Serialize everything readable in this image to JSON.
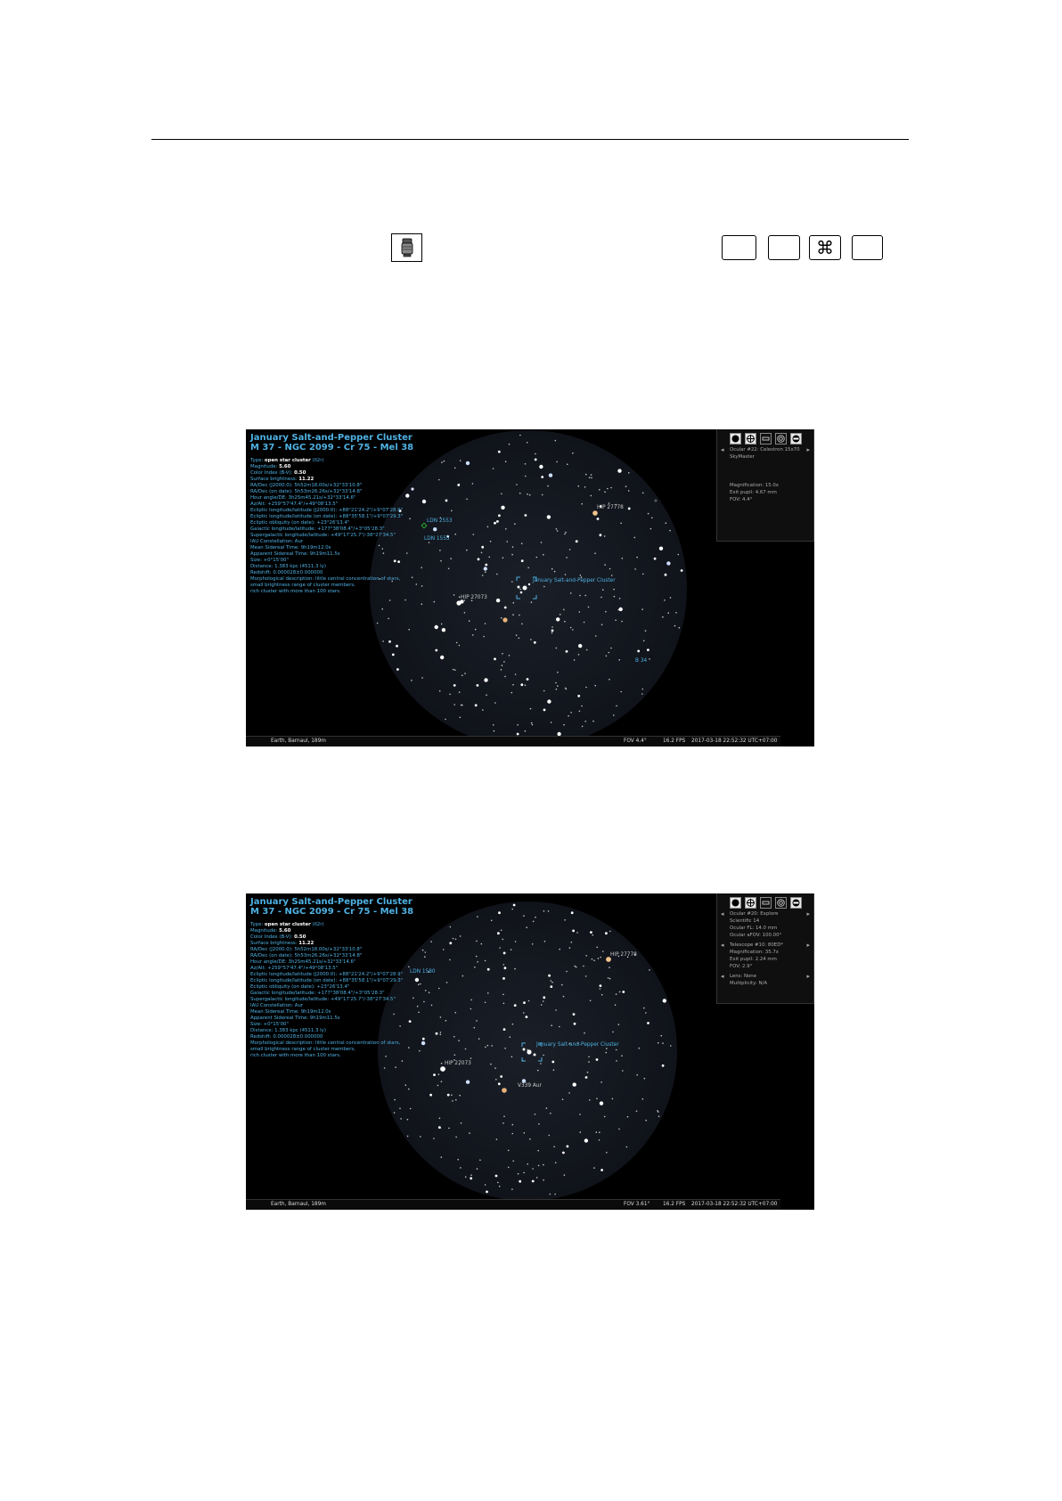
{
  "toolbar": {
    "ocular_icon": "ocular-icon",
    "keys": [
      "",
      "",
      "⌘",
      ""
    ]
  },
  "shot1": {
    "object_title": "January Salt-and-Pepper Cluster",
    "object_subtitle": "M 37 - NGC 2099 - Cr 75 - Mel 38",
    "info_lines": [
      {
        "k": "Type: ",
        "v": "open star cluster",
        "s": " (II2r)"
      },
      {
        "k": "Magnitude: ",
        "v": "5.60",
        "s": ""
      },
      {
        "k": "Color Index (B-V): ",
        "v": "0.50",
        "s": ""
      },
      {
        "k": "Surface brightness: ",
        "v": "11.22",
        "s": ""
      },
      {
        "k": "RA/Dec (J2000.0): 5h52m18.00s/+32°33'10.8\"",
        "v": "",
        "s": ""
      },
      {
        "k": "RA/Dec (on date): 5h53m26.26s/+32°33'14.8\"",
        "v": "",
        "s": ""
      },
      {
        "k": "Hour angle/DE: 3h25m45.21s/+32°33'14.6\"",
        "v": "",
        "s": ""
      },
      {
        "k": "Az/Alt: +259°57'47.4\"/+49°08'13.5\"",
        "v": "",
        "s": ""
      },
      {
        "k": "Ecliptic longitude/latitude (J2000.0): +88°21'24.2\"/+9°07'28.9\"",
        "v": "",
        "s": ""
      },
      {
        "k": "Ecliptic longitude/latitude (on date): +88°35'58.1\"/+9°07'29.3\"",
        "v": "",
        "s": ""
      },
      {
        "k": "Ecliptic obliquity (on date): +23°26'13.4\"",
        "v": "",
        "s": ""
      },
      {
        "k": "Galactic longitude/latitude: +177°38'08.4\"/+3°05'28.3\"",
        "v": "",
        "s": ""
      },
      {
        "k": "Supergalactic longitude/latitude: +49°17'25.7\"/-38°27'34.5\"",
        "v": "",
        "s": ""
      },
      {
        "k": "IAU Constellation: Aur",
        "v": "",
        "s": ""
      },
      {
        "k": "Mean Sidereal Time: 9h19m12.0s",
        "v": "",
        "s": ""
      },
      {
        "k": "Apparent Sidereal Time: 9h19m11.5s",
        "v": "",
        "s": ""
      },
      {
        "k": "Size: +0°15'00\"",
        "v": "",
        "s": ""
      },
      {
        "k": "Distance: 1.383 kpc (4511.3 ly)",
        "v": "",
        "s": ""
      },
      {
        "k": "Redshift: 0.000028±0.000000",
        "v": "",
        "s": ""
      },
      {
        "k": "Morphological description: little central concentration of stars,",
        "v": "",
        "s": ""
      },
      {
        "k": "small brightness range of cluster members,",
        "v": "",
        "s": ""
      },
      {
        "k": "rich cluster with more than 100 stars.",
        "v": "",
        "s": ""
      }
    ],
    "panel": {
      "ocular": "Ocular #22: Celestron 15x70",
      "ocular2": "SkyMaster",
      "magnification": "Magnification: 15.0x",
      "exit_pupil": "Exit pupil: 4.67 mm",
      "fov": "FOV: 4.4°"
    },
    "labels": {
      "hip_a": "HIP 27778",
      "hip_b": "HIP 27073",
      "ldn_a": "LDN 2553",
      "ldn_b": "LDN 1555",
      "cluster": "January Salt-and-Pepper Cluster",
      "b34": "B 34"
    },
    "status": {
      "location": "Earth, Barnaul, 189m",
      "fov": "FOV 4.4°",
      "fps": "16.2 FPS",
      "datetime": "2017-03-18 22:52:32 UTC+07:00"
    }
  },
  "shot2": {
    "object_title": "January Salt-and-Pepper Cluster",
    "object_subtitle": "M 37 - NGC 2099 - Cr 75 - Mel 38",
    "panel": {
      "ocular": "Ocular #20: Explore",
      "ocular2": "Scientific 14",
      "ocular_fl": "Ocular FL: 14.0 mm",
      "ocular_afov": "Ocular aFOV: 100.00°",
      "telescope": "Telescope #10: 80ED*",
      "magnification": "Magnification: 35.7x",
      "exit_pupil": "Exit pupil: 2.24 mm",
      "fov": "FOV: 2.9°",
      "lens": "Lens: None",
      "multiplicity": "Multiplicity: N/A"
    },
    "labels": {
      "hip_a": "HIP 27778",
      "hip_b": "HIP 27073",
      "ld": "LDN 1580",
      "cluster": "January Salt-and-Pepper Cluster",
      "v": "V339 Aur"
    },
    "status": {
      "location": "Earth, Barnaul, 189m",
      "fov": "FOV 3.61°",
      "fps": "16.2 FPS",
      "datetime": "2017-03-18 22:52:32 UTC+07:00"
    }
  },
  "colors": {
    "label_blue": "#4fb1e3",
    "sky": "#000000",
    "fov_disc": "#14181f"
  }
}
